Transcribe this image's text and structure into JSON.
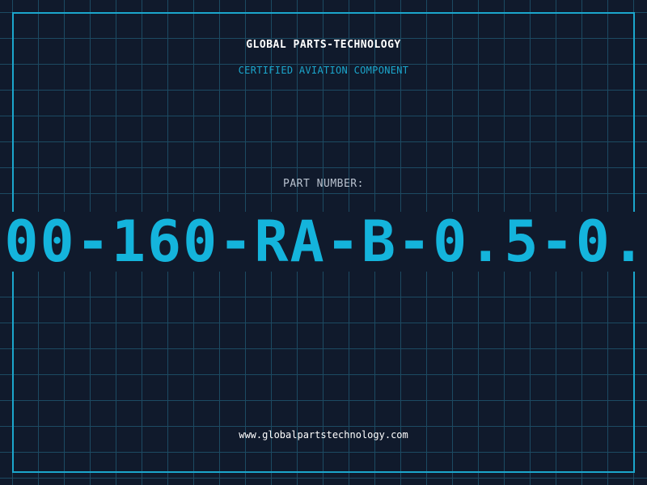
{
  "header": {
    "company": "GLOBAL PARTS-TECHNOLOGY",
    "subtitle": "CERTIFIED AVIATION COMPONENT"
  },
  "part": {
    "label": "PART NUMBER:",
    "value_visible": "00-160-RA-B-0.5-0."
  },
  "footer": {
    "url": "www.globalpartstechnology.com"
  },
  "colors": {
    "background": "#101a2c",
    "grid": "#1c4a62",
    "accent": "#1ba6cc",
    "part_number": "#14b4dc",
    "text": "#ffffff",
    "muted": "#b9c2cf"
  }
}
